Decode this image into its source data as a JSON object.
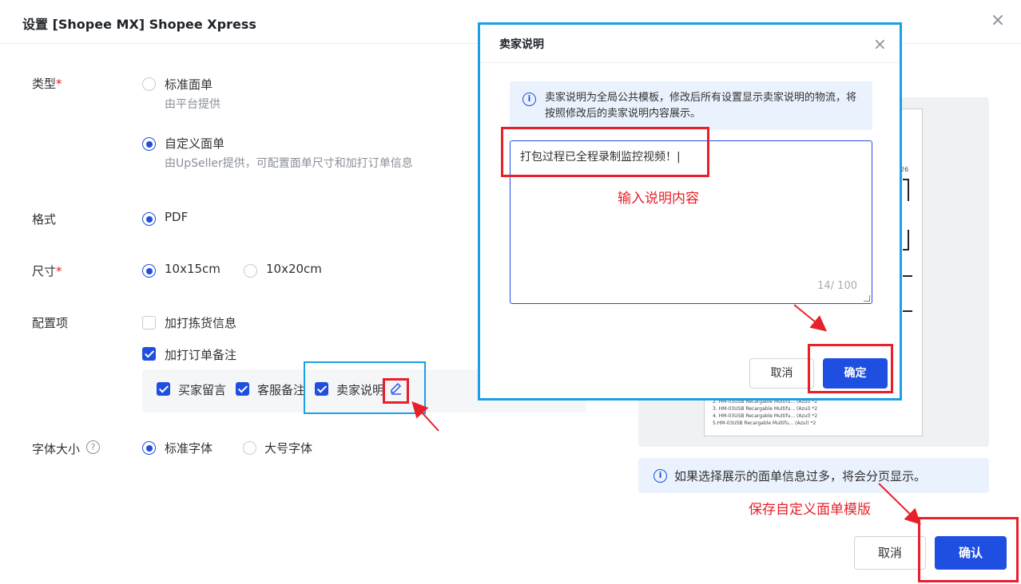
{
  "dialog": {
    "title": "设置 [Shopee MX] Shopee Xpress",
    "close_icon": "close-icon"
  },
  "form": {
    "type": {
      "label": "类型",
      "required_mark": "*",
      "options": [
        {
          "label": "标准面单",
          "desc": "由平台提供",
          "selected": false
        },
        {
          "label": "自定义面单",
          "desc": "由UpSeller提供，可配置面单尺寸和加打订单信息",
          "selected": true
        }
      ]
    },
    "format": {
      "label": "格式",
      "options": [
        {
          "label": "PDF",
          "selected": true
        }
      ]
    },
    "size": {
      "label": "尺寸",
      "required_mark": "*",
      "options": [
        {
          "label": "10x15cm",
          "selected": true
        },
        {
          "label": "10x20cm",
          "selected": false
        }
      ]
    },
    "config": {
      "label": "配置项",
      "pick_info": {
        "label": "加打拣货信息",
        "checked": false
      },
      "order_note": {
        "label": "加打订单备注",
        "checked": true
      },
      "sub_items": [
        {
          "label": "买家留言",
          "checked": true
        },
        {
          "label": "客服备注",
          "checked": true
        },
        {
          "label": "卖家说明",
          "checked": true
        }
      ]
    },
    "font_size": {
      "label": "字体大小",
      "help": "?",
      "options": [
        {
          "label": "标准字体",
          "selected": true
        },
        {
          "label": "大号字体",
          "selected": false
        }
      ]
    }
  },
  "preview": {
    "date_fragment": "26",
    "items": [
      "2. HM-03USB Recargable Multifu... (Azul) *2",
      "3. HM-03USB Recargable Multifu... (Azul) *2",
      "4. HM-03USB Recargable Multifu... (Azul) *2",
      "5.HM-03USB Recargable Multifu... (Azul) *2"
    ]
  },
  "info": {
    "icon": "i",
    "text": "如果选择展示的面单信息过多，将会分页显示。"
  },
  "footer": {
    "cancel_label": "取消",
    "confirm_label": "确认"
  },
  "modal": {
    "title": "卖家说明",
    "tip_icon": "i",
    "tip": "卖家说明为全局公共模板，修改后所有设置显示卖家说明的物流，将按照修改后的卖家说明内容展示。",
    "textarea_value": "打包过程已全程录制监控视频！|",
    "count": "14/ 100",
    "cancel_label": "取消",
    "ok_label": "确定"
  },
  "annotations": {
    "input_hint": "输入说明内容",
    "save_hint": "保存自定义面单模版"
  },
  "colors": {
    "primary": "#1f4fe0",
    "annotation_red": "#e8202a",
    "annotation_blue": "#1aa0e6"
  }
}
